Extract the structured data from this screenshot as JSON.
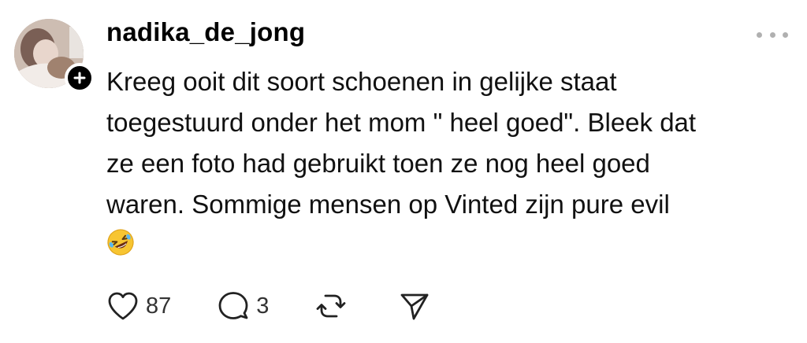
{
  "post": {
    "username": "nadika_de_jong",
    "text": "Kreeg ooit dit soort schoenen in gelijke staat\ntoegestuurd onder het mom \" heel goed\". Bleek dat\nze een foto had gebruikt toen ze nog heel goed\nwaren. Sommige mensen op Vinted zijn pure evil",
    "emoji": "🤣",
    "likes": "87",
    "replies": "3"
  },
  "icons": {
    "avatar": "profile-photo",
    "follow": "plus-icon",
    "more": "more-horizontal-icon",
    "like": "heart-icon",
    "reply": "comment-bubble-icon",
    "repost": "repost-icon",
    "share": "send-icon"
  },
  "colors": {
    "text": "#111111",
    "muted": "#b0b0b0",
    "badge": "#000000"
  }
}
